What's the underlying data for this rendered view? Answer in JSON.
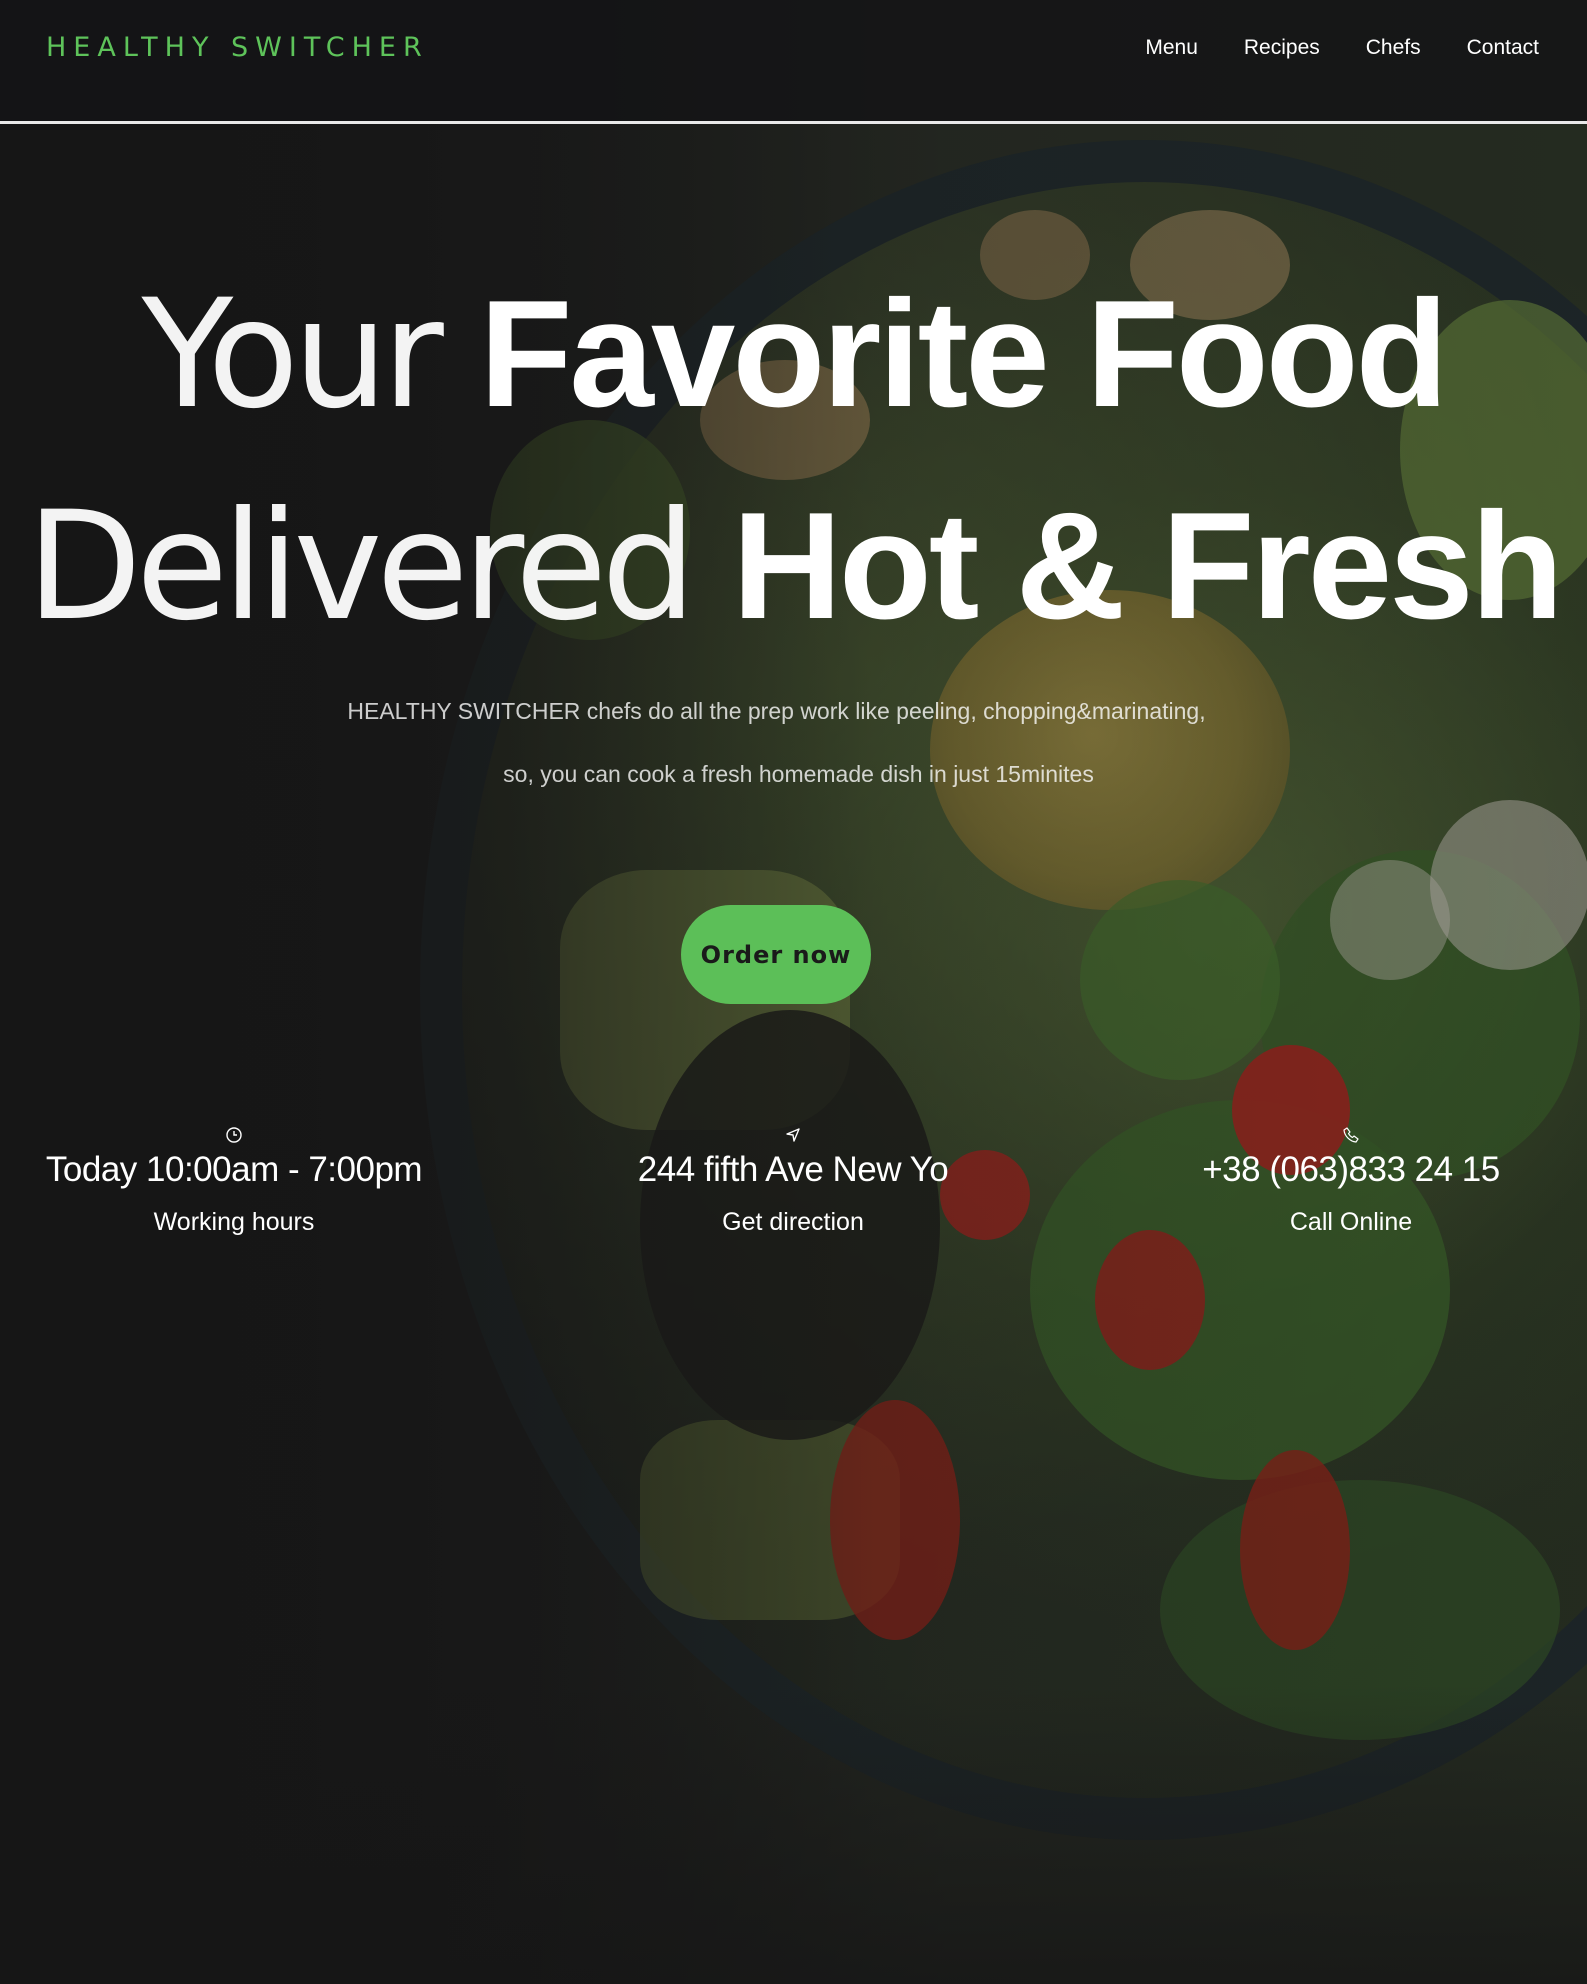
{
  "brand": {
    "logo_text": "HEALTHY SWITCHER",
    "accent_color": "#5ec35a"
  },
  "nav": {
    "items": [
      {
        "label": "Menu"
      },
      {
        "label": "Recipes"
      },
      {
        "label": "Chefs"
      },
      {
        "label": "Contact"
      }
    ]
  },
  "hero": {
    "line1_thin": "Your ",
    "line1_bold": "Favorite Food",
    "line2_thin": "Delivered ",
    "line2_bold": "Hot & Fresh",
    "subtitle_1": "HEALTHY SWITCHER chefs do all the prep work like peeling, chopping&marinating,",
    "subtitle_2": "so, you can cook a fresh homemade dish in just 15minites",
    "cta_label": "Order now",
    "cta_color": "#5cbf58"
  },
  "info": {
    "hours": {
      "icon": "clock-icon",
      "value": "Today 10:00am - 7:00pm",
      "label": "Working hours"
    },
    "location": {
      "icon": "navigation-arrow-icon",
      "value": "244 fifth Ave New Yo",
      "label": "Get direction"
    },
    "phone": {
      "icon": "phone-icon",
      "value": "+38 (063)833 24 15",
      "label": "Call Online"
    }
  }
}
